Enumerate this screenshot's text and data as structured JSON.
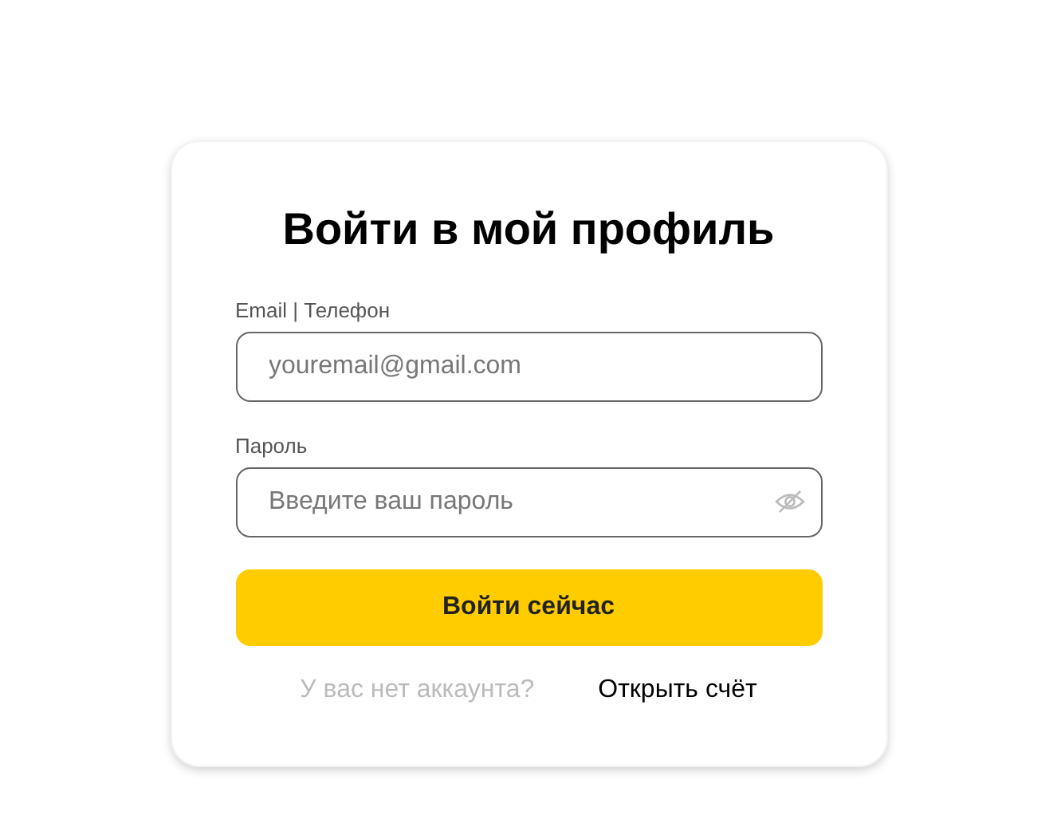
{
  "title": "Войти в мой профиль",
  "fields": [
    {
      "label": "Email | Телефон",
      "placeholder": "youremail@gmail.com",
      "kind": "text"
    },
    {
      "label": "Пароль",
      "placeholder": "Введите ваш пароль",
      "kind": "password"
    }
  ],
  "submit": "Войти сейчас",
  "footer": {
    "question": "У вас нет аккаунта?",
    "link": "Открыть счёт"
  }
}
